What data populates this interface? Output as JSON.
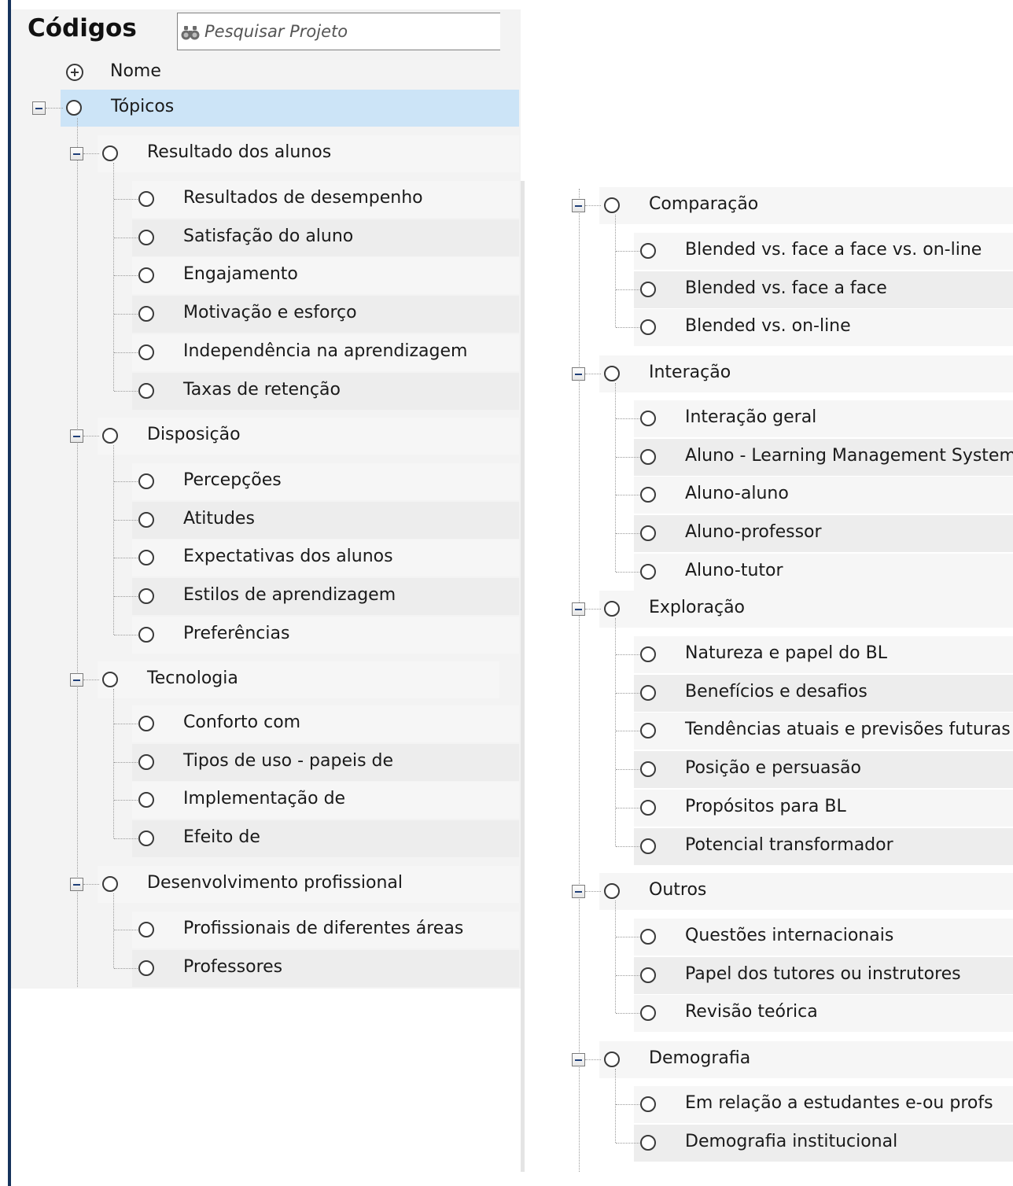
{
  "header": {
    "title": "Códigos",
    "search_placeholder": "Pesquisar Projeto",
    "search_icon": "binoculars-icon"
  },
  "columns": {
    "name_header": "Nome"
  },
  "tree": {
    "root": {
      "label": "Tópicos",
      "selected": true,
      "expanded": true
    },
    "groups": [
      {
        "label": "Resultado dos alunos",
        "expanded": true,
        "children": [
          "Resultados de desempenho",
          "Satisfação do aluno",
          "Engajamento",
          "Motivação e esforço",
          "Independência na aprendizagem",
          "Taxas de retenção"
        ]
      },
      {
        "label": "Disposição",
        "expanded": true,
        "children": [
          "Percepções",
          "Atitudes",
          "Expectativas dos alunos",
          "Estilos de aprendizagem",
          "Preferências"
        ]
      },
      {
        "label": "Tecnologia",
        "expanded": true,
        "children": [
          "Conforto com",
          "Tipos de uso - papeis de",
          "Implementação de",
          "Efeito de"
        ]
      },
      {
        "label": "Desenvolvimento profissional",
        "expanded": true,
        "children": [
          "Profissionais de diferentes áreas",
          "Professores"
        ]
      },
      {
        "label": "Comparação",
        "expanded": true,
        "children": [
          "Blended vs. face a face vs. on-line",
          "Blended vs. face a face",
          "Blended vs. on-line"
        ]
      },
      {
        "label": "Interação",
        "expanded": true,
        "children": [
          "Interação geral",
          "Aluno - Learning Management Systems",
          "Aluno-aluno",
          "Aluno-professor",
          "Aluno-tutor"
        ]
      },
      {
        "label": "Exploração",
        "expanded": true,
        "children": [
          "Natureza e papel do BL",
          "Benefícios e desafios",
          "Tendências atuais e previsões futuras",
          "Posição e persuasão",
          "Propósitos para BL",
          "Potencial transformador"
        ]
      },
      {
        "label": "Outros",
        "expanded": true,
        "children": [
          "Questões internacionais",
          "Papel dos tutores ou instrutores",
          "Revisão teórica"
        ]
      },
      {
        "label": "Demografia",
        "expanded": true,
        "children": [
          "Em relação a estudantes e-ou profs",
          "Demografia institucional"
        ]
      }
    ]
  }
}
